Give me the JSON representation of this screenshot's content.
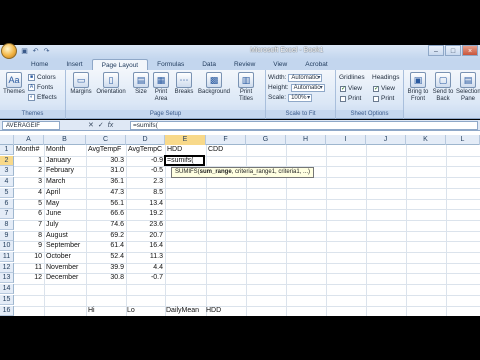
{
  "app": {
    "window_title": "Microsoft Excel - Book1",
    "qat": [
      "save-icon",
      "undo-icon",
      "redo-icon"
    ],
    "window_controls": [
      "–",
      "□",
      "×"
    ]
  },
  "tabs": [
    "Home",
    "Insert",
    "Page Layout",
    "Formulas",
    "Data",
    "Review",
    "View",
    "Acrobat"
  ],
  "active_tab": "Page Layout",
  "ribbon": {
    "themes": {
      "label": "Themes",
      "big": "Themes",
      "colors": "Colors",
      "fonts": "Fonts",
      "effects": "Effects"
    },
    "page_setup": {
      "label": "Page Setup",
      "buttons": [
        "Margins",
        "Orientation",
        "Size",
        "Print Area",
        "Breaks",
        "Background",
        "Print Titles"
      ]
    },
    "scale_to_fit": {
      "label": "Scale to Fit",
      "width_label": "Width:",
      "width_value": "Automatic",
      "height_label": "Height:",
      "height_value": "Automatic",
      "scale_label": "Scale:",
      "scale_value": "100%"
    },
    "sheet_options": {
      "label": "Sheet Options",
      "gridlines": "Gridlines",
      "headings": "Headings",
      "view": "View",
      "print": "Print"
    },
    "arrange": {
      "buttons": [
        "Bring to Front",
        "Send to Back",
        "Selection Pane"
      ]
    }
  },
  "formula_bar": {
    "name_box": "AVERAGEIF",
    "cancel": "✕",
    "enter": "✓",
    "fx": "fx",
    "formula": "=sumifs("
  },
  "sheet": {
    "columns": [
      "A",
      "B",
      "C",
      "D",
      "E",
      "F",
      "G",
      "H",
      "I",
      "J",
      "K",
      "L",
      "M"
    ],
    "rows": [
      "1",
      "2",
      "3",
      "4",
      "5",
      "6",
      "7",
      "8",
      "9",
      "10",
      "11",
      "12",
      "13",
      "14",
      "15",
      "16"
    ],
    "header_row": [
      "Month#",
      "Month",
      "AvgTempF",
      "AvgTempC",
      "HDD",
      "CDD"
    ],
    "data": [
      [
        "1",
        "January",
        "30.3",
        "-0.9"
      ],
      [
        "2",
        "February",
        "31.0",
        "-0.5"
      ],
      [
        "3",
        "March",
        "36.1",
        "2.3"
      ],
      [
        "4",
        "April",
        "47.3",
        "8.5"
      ],
      [
        "5",
        "May",
        "56.1",
        "13.4"
      ],
      [
        "6",
        "June",
        "66.6",
        "19.2"
      ],
      [
        "7",
        "July",
        "74.6",
        "23.6"
      ],
      [
        "8",
        "August",
        "69.2",
        "20.7"
      ],
      [
        "9",
        "September",
        "61.4",
        "16.4"
      ],
      [
        "10",
        "October",
        "52.4",
        "11.3"
      ],
      [
        "11",
        "November",
        "39.9",
        "4.4"
      ],
      [
        "12",
        "December",
        "30.8",
        "-0.7"
      ]
    ],
    "row16": [
      "Hi",
      "Lo",
      "DailyMean",
      "HDD"
    ],
    "active_cell_text": "=sumifs(",
    "tooltip_fn": "SUMIFS(",
    "tooltip_bold": "sum_range",
    "tooltip_rest": ", criteria_range1, criteria1, ...)"
  }
}
